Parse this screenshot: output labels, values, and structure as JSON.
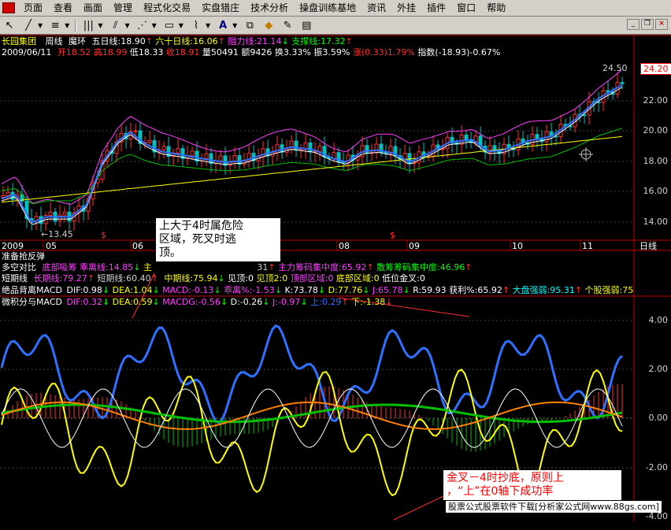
{
  "menu": [
    "页面",
    "查看",
    "画面",
    "管理",
    "程式化交易",
    "实盘猎庄",
    "技术分析",
    "操盘训练基地",
    "资讯",
    "外挂",
    "插件",
    "窗口",
    "帮助"
  ],
  "info": {
    "stock": "长园集团",
    "period": "周线",
    "indicator": "魔环",
    "ma5": "五日线:18.90",
    "ma60": "六十日线:16.06",
    "resistance": "阻力线:21.14",
    "support": "支撑线:17.32",
    "date": "2009/06/11",
    "open": "开18.52",
    "high": "高18.99",
    "low": "低18.33",
    "close": "收18.91",
    "volume": "量50491",
    "amount": "额9426",
    "turnover": "换3.33%",
    "amplitude": "振3.59%",
    "change": "涨(0.33)1.79%",
    "index": "指数(-18.93)-0.67%"
  },
  "price_axis": [
    "22.00",
    "20.00",
    "18.00",
    "16.00",
    "14.00"
  ],
  "price_last": "24.20",
  "price_high_label": "24.50",
  "price_low_label": "13.45",
  "time_axis": [
    "2009",
    "05",
    "06",
    "08",
    "09",
    "10",
    "11"
  ],
  "time_axis_right": "日线",
  "panels": {
    "p1": "准备抢反弹",
    "p2_label": "多空对比",
    "p2_a": "底部吸筹",
    "p2_b": "乖离线:14.85",
    "p2_c": "主",
    "p2_d": "31",
    "p2_e": "主力筹码集中度:65.92",
    "p2_f": "散筹筹码集中度:46.96",
    "p3_label": "短期线",
    "p3_a": "长期线:79.27",
    "p3_b": "短期线:60.40",
    "p3_c": "中期线:75.94",
    "p3_d": "见顶:0",
    "p3_e": "见顶2:0",
    "p3_f": "顶部区域:0",
    "p3_g": "底部区域:0",
    "p3_h": "低位金叉:0",
    "p4_label": "绝品背离MACD",
    "p4_a": "DIF:0.98",
    "p4_b": "DEA:1.04",
    "p4_c": "MACD:-0.13",
    "p4_d": "乖离%:-1.53",
    "p4_e": "K:73.78",
    "p4_f": "D:77.76",
    "p4_g": "J:65.78",
    "p4_h": "R:59.93",
    "p4_i": "获利%:65.92",
    "p4_j": "大盘强弱:95.31",
    "p4_k": "个股强弱:75",
    "p5_label": "微积分与MACD",
    "p5_a": "DIF:0.32",
    "p5_b": "DEA:0.59",
    "p5_c": "MACDG:-0.56",
    "p5_d": "D:-0.26",
    "p5_e": "J:-0.97",
    "p5_f": "上:0.29",
    "p5_g": "下:-1.38"
  },
  "osc_axis": [
    "4.00",
    "2.00",
    "0.00",
    "-2.00",
    "-4.00"
  ],
  "annotations": {
    "top_line1": "上大于4时属危险",
    "top_line2": "区域，死叉时逃",
    "top_line3": "顶。",
    "bottom_line1": "金叉－4时抄底，原则上",
    "bottom_line2": "，“上”在0轴下成功率"
  },
  "watermark": "股票公式股票软件下载[分析家公式网www.88gs.com]",
  "colors": {
    "up": "#ff3030",
    "down": "#00c0c0",
    "yellow": "#ffff00",
    "magenta": "#ff40ff",
    "blue": "#3070ff"
  }
}
